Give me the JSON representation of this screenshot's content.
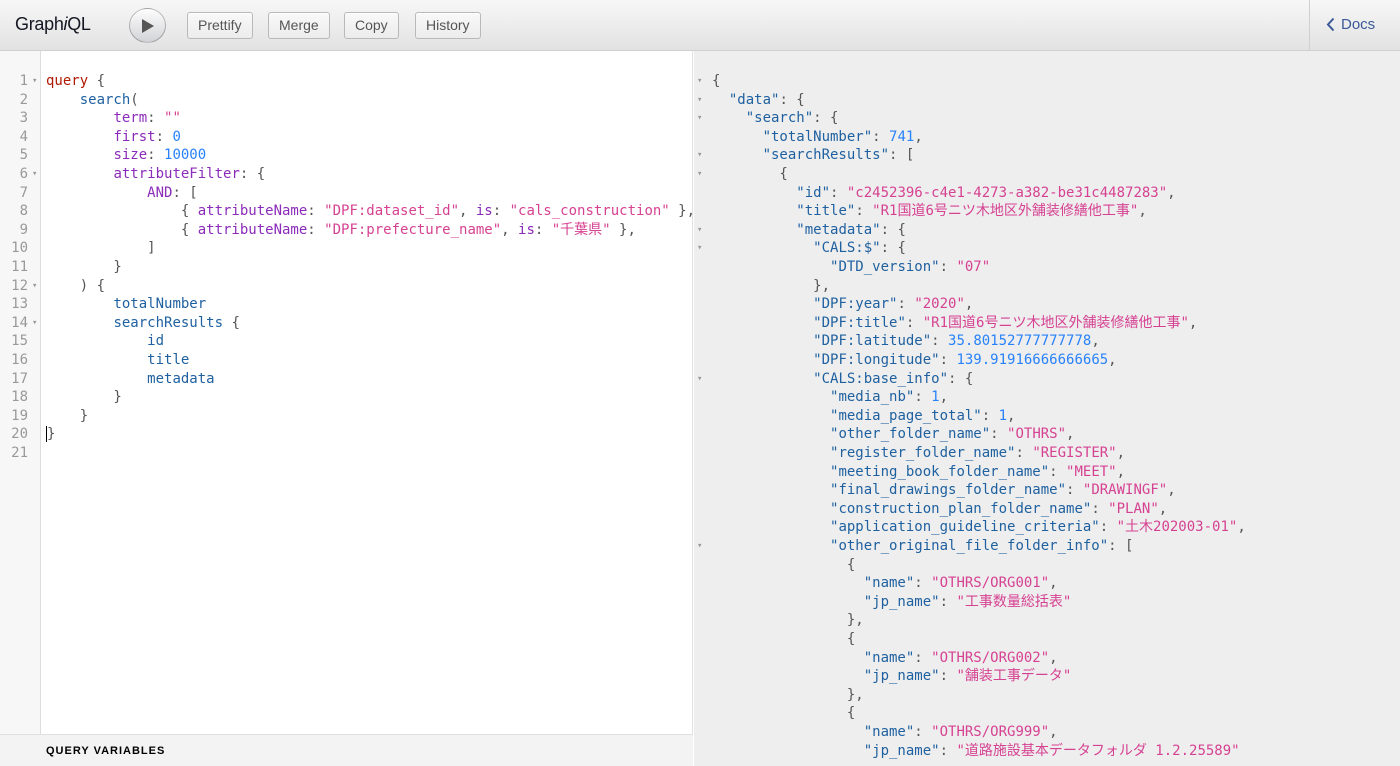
{
  "toolbar": {
    "title_prefix": "Graph",
    "title_italic": "i",
    "title_suffix": "QL",
    "prettify": "Prettify",
    "merge": "Merge",
    "copy": "Copy",
    "history": "History",
    "docs": "Docs"
  },
  "variables_label": "QUERY VARIABLES",
  "query_lines": [
    {
      "n": "1",
      "fold": true,
      "parts": [
        [
          "kw",
          "query"
        ],
        [
          "pun",
          " {"
        ]
      ]
    },
    {
      "n": "2",
      "parts": [
        [
          "pun",
          "    "
        ],
        [
          "fld",
          "search"
        ],
        [
          "pun",
          "("
        ]
      ]
    },
    {
      "n": "3",
      "parts": [
        [
          "pun",
          "        "
        ],
        [
          "arg",
          "term"
        ],
        [
          "pun",
          ": "
        ],
        [
          "str",
          "\"\""
        ]
      ]
    },
    {
      "n": "4",
      "parts": [
        [
          "pun",
          "        "
        ],
        [
          "arg",
          "first"
        ],
        [
          "pun",
          ": "
        ],
        [
          "num",
          "0"
        ]
      ]
    },
    {
      "n": "5",
      "parts": [
        [
          "pun",
          "        "
        ],
        [
          "arg",
          "size"
        ],
        [
          "pun",
          ": "
        ],
        [
          "num",
          "10000"
        ]
      ]
    },
    {
      "n": "6",
      "fold": true,
      "parts": [
        [
          "pun",
          "        "
        ],
        [
          "arg",
          "attributeFilter"
        ],
        [
          "pun",
          ": {"
        ]
      ]
    },
    {
      "n": "7",
      "parts": [
        [
          "pun",
          "            "
        ],
        [
          "arg",
          "AND"
        ],
        [
          "pun",
          ": ["
        ]
      ]
    },
    {
      "n": "8",
      "parts": [
        [
          "pun",
          "                { "
        ],
        [
          "arg",
          "attributeName"
        ],
        [
          "pun",
          ": "
        ],
        [
          "str",
          "\"DPF:dataset_id\""
        ],
        [
          "pun",
          ", "
        ],
        [
          "arg",
          "is"
        ],
        [
          "pun",
          ": "
        ],
        [
          "str",
          "\"cals_construction\""
        ],
        [
          "pun",
          " },"
        ]
      ]
    },
    {
      "n": "9",
      "parts": [
        [
          "pun",
          "                { "
        ],
        [
          "arg",
          "attributeName"
        ],
        [
          "pun",
          ": "
        ],
        [
          "str",
          "\"DPF:prefecture_name\""
        ],
        [
          "pun",
          ", "
        ],
        [
          "arg",
          "is"
        ],
        [
          "pun",
          ": "
        ],
        [
          "str",
          "\"千葉県\""
        ],
        [
          "pun",
          " },"
        ]
      ]
    },
    {
      "n": "10",
      "parts": [
        [
          "pun",
          "            ]"
        ]
      ]
    },
    {
      "n": "11",
      "parts": [
        [
          "pun",
          "        }"
        ]
      ]
    },
    {
      "n": "12",
      "fold": true,
      "parts": [
        [
          "pun",
          "    ) {"
        ]
      ]
    },
    {
      "n": "13",
      "parts": [
        [
          "pun",
          "        "
        ],
        [
          "fld",
          "totalNumber"
        ]
      ]
    },
    {
      "n": "14",
      "fold": true,
      "parts": [
        [
          "pun",
          "        "
        ],
        [
          "fld",
          "searchResults"
        ],
        [
          "pun",
          " {"
        ]
      ]
    },
    {
      "n": "15",
      "parts": [
        [
          "pun",
          "            "
        ],
        [
          "fld",
          "id"
        ]
      ]
    },
    {
      "n": "16",
      "parts": [
        [
          "pun",
          "            "
        ],
        [
          "fld",
          "title"
        ]
      ]
    },
    {
      "n": "17",
      "parts": [
        [
          "pun",
          "            "
        ],
        [
          "fld",
          "metadata"
        ]
      ]
    },
    {
      "n": "18",
      "parts": [
        [
          "pun",
          "        }"
        ]
      ]
    },
    {
      "n": "19",
      "parts": [
        [
          "pun",
          "    }"
        ]
      ]
    },
    {
      "n": "20",
      "parts": [
        [
          "pun",
          "}"
        ]
      ]
    },
    {
      "n": "21",
      "parts": []
    }
  ],
  "result_lines": [
    {
      "fold": true,
      "parts": [
        [
          "pun",
          "{"
        ]
      ]
    },
    {
      "fold": true,
      "parts": [
        [
          "pun",
          "  "
        ],
        [
          "fld",
          "\"data\""
        ],
        [
          "pun",
          ": {"
        ]
      ]
    },
    {
      "fold": true,
      "parts": [
        [
          "pun",
          "    "
        ],
        [
          "fld",
          "\"search\""
        ],
        [
          "pun",
          ": {"
        ]
      ]
    },
    {
      "parts": [
        [
          "pun",
          "      "
        ],
        [
          "fld",
          "\"totalNumber\""
        ],
        [
          "pun",
          ": "
        ],
        [
          "num",
          "741"
        ],
        [
          "pun",
          ","
        ]
      ]
    },
    {
      "fold": true,
      "parts": [
        [
          "pun",
          "      "
        ],
        [
          "fld",
          "\"searchResults\""
        ],
        [
          "pun",
          ": ["
        ]
      ]
    },
    {
      "fold": true,
      "parts": [
        [
          "pun",
          "        {"
        ]
      ]
    },
    {
      "parts": [
        [
          "pun",
          "          "
        ],
        [
          "fld",
          "\"id\""
        ],
        [
          "pun",
          ": "
        ],
        [
          "str",
          "\"c2452396-c4e1-4273-a382-be31c4487283\""
        ],
        [
          "pun",
          ","
        ]
      ]
    },
    {
      "parts": [
        [
          "pun",
          "          "
        ],
        [
          "fld",
          "\"title\""
        ],
        [
          "pun",
          ": "
        ],
        [
          "str",
          "\"R1国道6号ニツ木地区外舗装修繕他工事\""
        ],
        [
          "pun",
          ","
        ]
      ]
    },
    {
      "fold": true,
      "parts": [
        [
          "pun",
          "          "
        ],
        [
          "fld",
          "\"metadata\""
        ],
        [
          "pun",
          ": {"
        ]
      ]
    },
    {
      "fold": true,
      "parts": [
        [
          "pun",
          "            "
        ],
        [
          "fld",
          "\"CALS:$\""
        ],
        [
          "pun",
          ": {"
        ]
      ]
    },
    {
      "parts": [
        [
          "pun",
          "              "
        ],
        [
          "fld",
          "\"DTD_version\""
        ],
        [
          "pun",
          ": "
        ],
        [
          "str",
          "\"07\""
        ]
      ]
    },
    {
      "parts": [
        [
          "pun",
          "            },"
        ]
      ]
    },
    {
      "parts": [
        [
          "pun",
          "            "
        ],
        [
          "fld",
          "\"DPF:year\""
        ],
        [
          "pun",
          ": "
        ],
        [
          "str",
          "\"2020\""
        ],
        [
          "pun",
          ","
        ]
      ]
    },
    {
      "parts": [
        [
          "pun",
          "            "
        ],
        [
          "fld",
          "\"DPF:title\""
        ],
        [
          "pun",
          ": "
        ],
        [
          "str",
          "\"R1国道6号ニツ木地区外舗装修繕他工事\""
        ],
        [
          "pun",
          ","
        ]
      ]
    },
    {
      "parts": [
        [
          "pun",
          "            "
        ],
        [
          "fld",
          "\"DPF:latitude\""
        ],
        [
          "pun",
          ": "
        ],
        [
          "num",
          "35.80152777777778"
        ],
        [
          "pun",
          ","
        ]
      ]
    },
    {
      "parts": [
        [
          "pun",
          "            "
        ],
        [
          "fld",
          "\"DPF:longitude\""
        ],
        [
          "pun",
          ": "
        ],
        [
          "num",
          "139.91916666666665"
        ],
        [
          "pun",
          ","
        ]
      ]
    },
    {
      "fold": true,
      "parts": [
        [
          "pun",
          "            "
        ],
        [
          "fld",
          "\"CALS:base_info\""
        ],
        [
          "pun",
          ": {"
        ]
      ]
    },
    {
      "parts": [
        [
          "pun",
          "              "
        ],
        [
          "fld",
          "\"media_nb\""
        ],
        [
          "pun",
          ": "
        ],
        [
          "num",
          "1"
        ],
        [
          "pun",
          ","
        ]
      ]
    },
    {
      "parts": [
        [
          "pun",
          "              "
        ],
        [
          "fld",
          "\"media_page_total\""
        ],
        [
          "pun",
          ": "
        ],
        [
          "num",
          "1"
        ],
        [
          "pun",
          ","
        ]
      ]
    },
    {
      "parts": [
        [
          "pun",
          "              "
        ],
        [
          "fld",
          "\"other_folder_name\""
        ],
        [
          "pun",
          ": "
        ],
        [
          "str",
          "\"OTHRS\""
        ],
        [
          "pun",
          ","
        ]
      ]
    },
    {
      "parts": [
        [
          "pun",
          "              "
        ],
        [
          "fld",
          "\"register_folder_name\""
        ],
        [
          "pun",
          ": "
        ],
        [
          "str",
          "\"REGISTER\""
        ],
        [
          "pun",
          ","
        ]
      ]
    },
    {
      "parts": [
        [
          "pun",
          "              "
        ],
        [
          "fld",
          "\"meeting_book_folder_name\""
        ],
        [
          "pun",
          ": "
        ],
        [
          "str",
          "\"MEET\""
        ],
        [
          "pun",
          ","
        ]
      ]
    },
    {
      "parts": [
        [
          "pun",
          "              "
        ],
        [
          "fld",
          "\"final_drawings_folder_name\""
        ],
        [
          "pun",
          ": "
        ],
        [
          "str",
          "\"DRAWINGF\""
        ],
        [
          "pun",
          ","
        ]
      ]
    },
    {
      "parts": [
        [
          "pun",
          "              "
        ],
        [
          "fld",
          "\"construction_plan_folder_name\""
        ],
        [
          "pun",
          ": "
        ],
        [
          "str",
          "\"PLAN\""
        ],
        [
          "pun",
          ","
        ]
      ]
    },
    {
      "parts": [
        [
          "pun",
          "              "
        ],
        [
          "fld",
          "\"application_guideline_criteria\""
        ],
        [
          "pun",
          ": "
        ],
        [
          "str",
          "\"土木202003-01\""
        ],
        [
          "pun",
          ","
        ]
      ]
    },
    {
      "fold": true,
      "parts": [
        [
          "pun",
          "              "
        ],
        [
          "fld",
          "\"other_original_file_folder_info\""
        ],
        [
          "pun",
          ": ["
        ]
      ]
    },
    {
      "parts": [
        [
          "pun",
          "                {"
        ]
      ]
    },
    {
      "parts": [
        [
          "pun",
          "                  "
        ],
        [
          "fld",
          "\"name\""
        ],
        [
          "pun",
          ": "
        ],
        [
          "str",
          "\"OTHRS/ORG001\""
        ],
        [
          "pun",
          ","
        ]
      ]
    },
    {
      "parts": [
        [
          "pun",
          "                  "
        ],
        [
          "fld",
          "\"jp_name\""
        ],
        [
          "pun",
          ": "
        ],
        [
          "str",
          "\"工事数量総括表\""
        ]
      ]
    },
    {
      "parts": [
        [
          "pun",
          "                },"
        ]
      ]
    },
    {
      "parts": [
        [
          "pun",
          "                {"
        ]
      ]
    },
    {
      "parts": [
        [
          "pun",
          "                  "
        ],
        [
          "fld",
          "\"name\""
        ],
        [
          "pun",
          ": "
        ],
        [
          "str",
          "\"OTHRS/ORG002\""
        ],
        [
          "pun",
          ","
        ]
      ]
    },
    {
      "parts": [
        [
          "pun",
          "                  "
        ],
        [
          "fld",
          "\"jp_name\""
        ],
        [
          "pun",
          ": "
        ],
        [
          "str",
          "\"舗装工事データ\""
        ]
      ]
    },
    {
      "parts": [
        [
          "pun",
          "                },"
        ]
      ]
    },
    {
      "parts": [
        [
          "pun",
          "                {"
        ]
      ]
    },
    {
      "parts": [
        [
          "pun",
          "                  "
        ],
        [
          "fld",
          "\"name\""
        ],
        [
          "pun",
          ": "
        ],
        [
          "str",
          "\"OTHRS/ORG999\""
        ],
        [
          "pun",
          ","
        ]
      ]
    },
    {
      "parts": [
        [
          "pun",
          "                  "
        ],
        [
          "fld",
          "\"jp_name\""
        ],
        [
          "pun",
          ": "
        ],
        [
          "str",
          "\"道路施設基本データフォルダ 1.2.25589\""
        ]
      ]
    }
  ]
}
